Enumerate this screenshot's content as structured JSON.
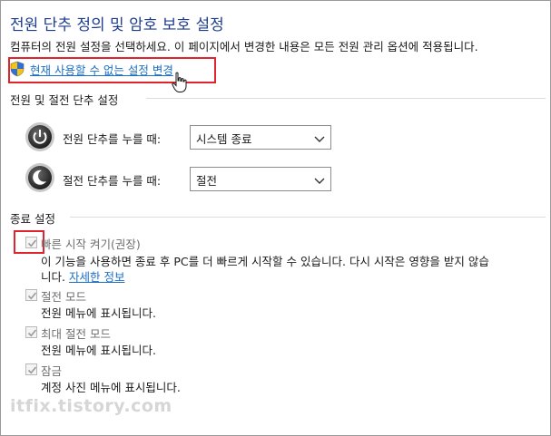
{
  "page": {
    "title": "전원 단추 정의 및 암호 보호 설정",
    "description": "컴퓨터의 전원 설정을 선택하세요. 이 페이지에서 변경한 내용은 모든 전원 관리 옵션에 적용됩니다.",
    "change_settings_link": "현재 사용할 수 없는 설정 변경"
  },
  "power_section": {
    "title": "전원 및 절전 단추 설정",
    "rows": [
      {
        "label": "전원 단추를 누를 때:",
        "value": "시스템 종료"
      },
      {
        "label": "절전 단추를 누를 때:",
        "value": "절전"
      }
    ]
  },
  "shutdown_section": {
    "title": "종료 설정",
    "options": [
      {
        "label": "빠른 시작 켜기(권장)",
        "checked": true,
        "enabled": false,
        "desc_line1": "이 기능을 사용하면 종료 후 PC를 더 빠르게 시작할 수 있습니다. 다시 시작은 영향을 받지 않습",
        "desc_line2_prefix": "니다.",
        "more_link": "자세한 정보"
      },
      {
        "label": "절전 모드",
        "checked": true,
        "enabled": false,
        "desc": "전원 메뉴에 표시됩니다."
      },
      {
        "label": "최대 절전 모드",
        "checked": true,
        "enabled": false,
        "desc": "전원 메뉴에 표시됩니다."
      },
      {
        "label": "잠금",
        "checked": true,
        "enabled": false,
        "desc": "계정 사진 메뉴에 표시됩니다."
      }
    ]
  },
  "watermark": "itfix.tistory.com",
  "icons": {
    "shield": "uac-shield-icon",
    "power": "power-button-icon",
    "sleep": "sleep-button-icon",
    "dropdown": "chevron-down-icon",
    "check": "checkmark-icon",
    "cursor": "hand-cursor-icon"
  },
  "colors": {
    "title": "#1e3d8f",
    "link": "#1d6fc4",
    "highlight_box": "#e0242e",
    "disabled_text": "#6e6e6e"
  }
}
